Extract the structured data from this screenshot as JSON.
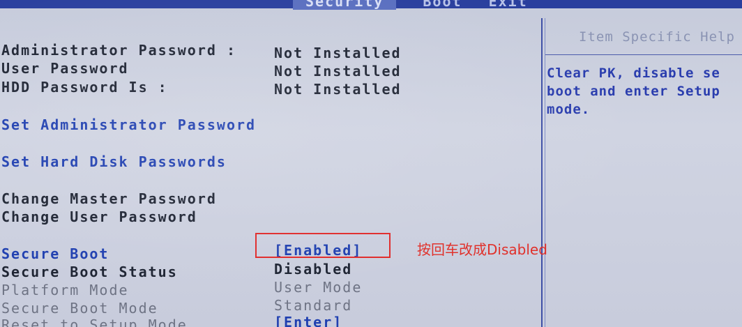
{
  "menu": {
    "tabs": [
      "Security",
      "Boot",
      "Exit"
    ],
    "active_tab": "Security"
  },
  "help_panel": {
    "title": "Item Specific Help",
    "lines": [
      "Clear PK, disable se",
      "boot and enter Setup",
      "mode."
    ]
  },
  "passwords": {
    "admin": {
      "label": "Administrator Password :",
      "value": "Not Installed"
    },
    "user": {
      "label": "User Password",
      "value": "Not Installed"
    },
    "hdd": {
      "label": "HDD Password Is :",
      "value": "Not Installed"
    }
  },
  "actions": {
    "set_admin": "Set Administrator Password",
    "set_hdd": "Set Hard Disk Passwords",
    "change_master": "Change Master Password",
    "change_user": "Change User Password"
  },
  "secure_boot": {
    "secure_boot": {
      "label": "Secure Boot",
      "value": "[Enabled]"
    },
    "status": {
      "label": "Secure Boot Status",
      "value": "Disabled"
    },
    "platform_mode": {
      "label": "Platform Mode",
      "value": "User Mode"
    },
    "boot_mode": {
      "label": "Secure Boot Mode",
      "value": "Standard"
    },
    "reset_setup": {
      "label": "Reset to Setup Mode",
      "value": "[Enter]"
    }
  },
  "annotation": {
    "text": "按回车改成Disabled",
    "color": "#e0302a"
  },
  "colors": {
    "background": "#c9cede",
    "accent_blue": "#1f3fb0",
    "divider": "#3e4fa6"
  }
}
